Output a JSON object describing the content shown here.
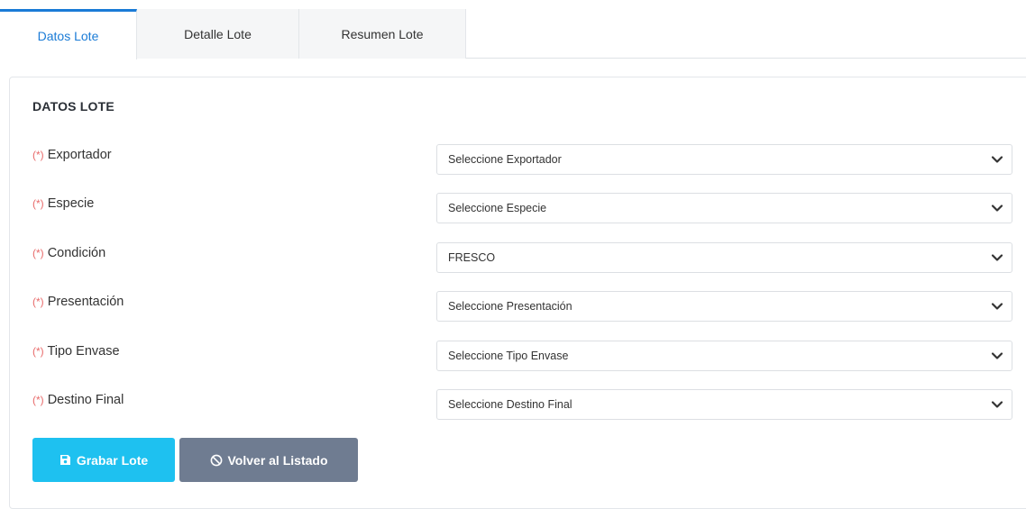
{
  "tabs": [
    {
      "label": "Datos Lote"
    },
    {
      "label": "Detalle Lote"
    },
    {
      "label": "Resumen Lote"
    }
  ],
  "form": {
    "title": "DATOS LOTE",
    "required_marker": "(*)",
    "fields": [
      {
        "label": "Exportador",
        "value": "Seleccione Exportador"
      },
      {
        "label": "Especie",
        "value": "Seleccione Especie"
      },
      {
        "label": "Condición",
        "value": "FRESCO"
      },
      {
        "label": "Presentación",
        "value": "Seleccione Presentación"
      },
      {
        "label": "Tipo Envase",
        "value": "Seleccione Tipo Envase"
      },
      {
        "label": "Destino Final",
        "value": "Seleccione Destino Final"
      }
    ]
  },
  "buttons": {
    "save": {
      "label": "Grabar Lote",
      "icon": "save-icon"
    },
    "back": {
      "label": "Volver al Listado",
      "icon": "ban-icon"
    }
  },
  "colors": {
    "accent": "#1a7bd6",
    "required": "#e86a6a",
    "save_button": "#1ec1f0",
    "back_button": "#6f7c91"
  }
}
